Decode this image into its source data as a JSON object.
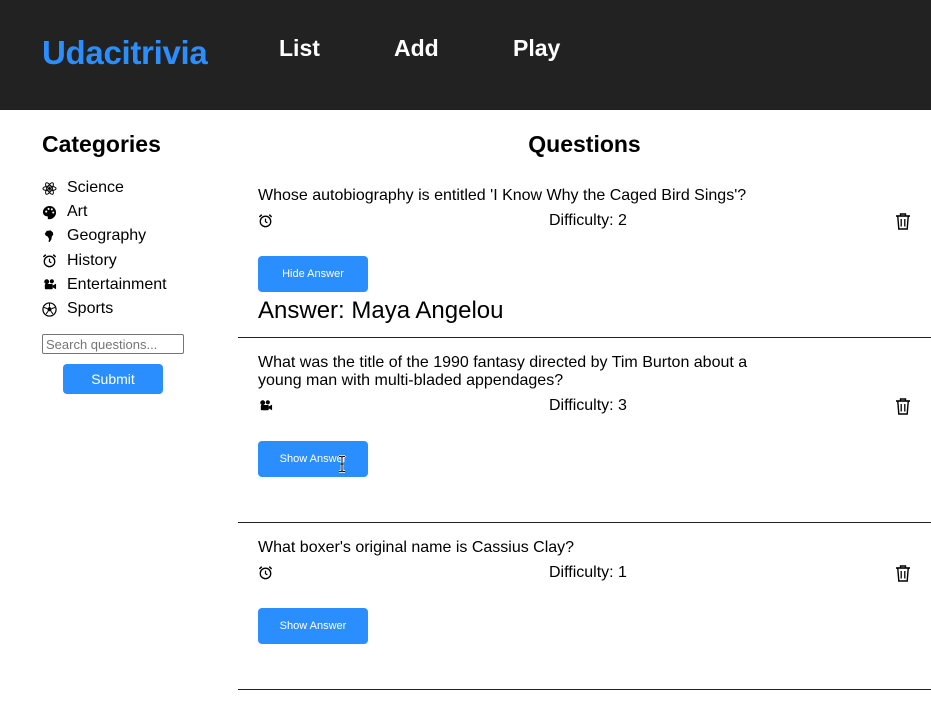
{
  "header": {
    "brand": "Udacitrivia",
    "nav": [
      {
        "label": "List"
      },
      {
        "label": "Add"
      },
      {
        "label": "Play"
      }
    ]
  },
  "sidebar": {
    "title": "Categories",
    "categories": [
      {
        "label": "Science",
        "icon": "science-icon"
      },
      {
        "label": "Art",
        "icon": "art-palette-icon"
      },
      {
        "label": "Geography",
        "icon": "geography-icon"
      },
      {
        "label": "History",
        "icon": "history-clock-icon"
      },
      {
        "label": "Entertainment",
        "icon": "entertainment-icon"
      },
      {
        "label": "Sports",
        "icon": "sports-ball-icon"
      }
    ],
    "search_placeholder": "Search questions...",
    "search_value": "",
    "submit_label": "Submit"
  },
  "main": {
    "title": "Questions",
    "questions": [
      {
        "text": "Whose autobiography is entitled 'I Know Why the Caged Bird Sings'?",
        "category_icon": "history-clock-icon",
        "difficulty": "Difficulty: 2",
        "button_label": "Hide Answer",
        "answer": "Answer: Maya Angelou"
      },
      {
        "text": "What was the title of the 1990 fantasy directed by Tim Burton about a young man with multi-bladed appendages?",
        "category_icon": "entertainment-icon",
        "difficulty": "Difficulty: 3",
        "button_label": "Show Answer"
      },
      {
        "text": "What boxer's original name is Cassius Clay?",
        "category_icon": "history-clock-icon",
        "difficulty": "Difficulty: 1",
        "button_label": "Show Answer"
      }
    ]
  },
  "colors": {
    "header_bg": "#222222",
    "accent": "#2b8eff",
    "nav_text": "#ffffff"
  }
}
